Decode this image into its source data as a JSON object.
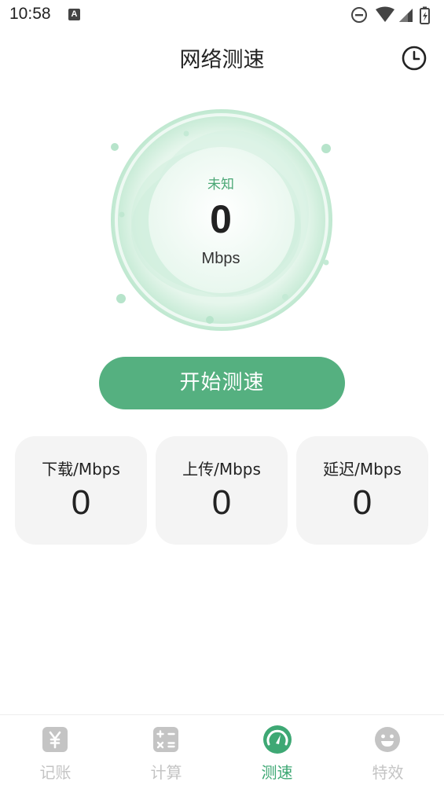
{
  "status_bar": {
    "time": "10:58",
    "notification_icon": "A"
  },
  "header": {
    "title": "网络测速",
    "history_icon": "clock-icon"
  },
  "gauge": {
    "status": "未知",
    "speed": "0",
    "unit": "Mbps"
  },
  "actions": {
    "start_label": "开始测速"
  },
  "stats": [
    {
      "label": "下载/Mbps",
      "value": "0"
    },
    {
      "label": "上传/Mbps",
      "value": "0"
    },
    {
      "label": "延迟/Mbps",
      "value": "0"
    }
  ],
  "bottom_nav": {
    "items": [
      {
        "label": "记账",
        "icon": "yuan-icon",
        "active": false
      },
      {
        "label": "计算",
        "icon": "calculator-icon",
        "active": false
      },
      {
        "label": "测速",
        "icon": "speedometer-icon",
        "active": true
      },
      {
        "label": "特效",
        "icon": "smiley-icon",
        "active": false
      }
    ]
  },
  "colors": {
    "accent": "#55b080",
    "accent_text": "#4aa775",
    "inactive_nav": "#c4c4c4",
    "card_bg": "#f4f4f4"
  }
}
